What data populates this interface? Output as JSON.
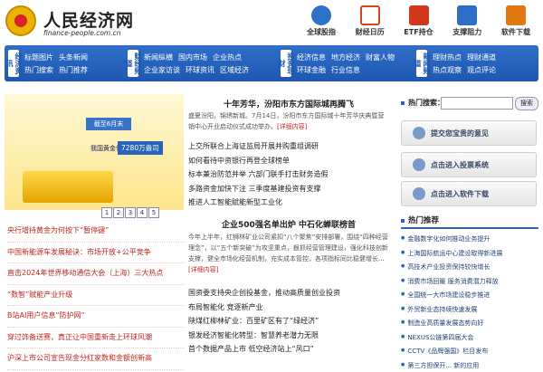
{
  "logo": {
    "name": "人民经济网",
    "url": "finance-people.com.cn"
  },
  "top_icons": [
    {
      "label": "全球股指",
      "icon": "globe-index-icon",
      "color": "#2d72c9"
    },
    {
      "label": "财经日历",
      "icon": "calendar-icon",
      "color": "#d8441c"
    },
    {
      "label": "ETF持仓",
      "icon": "etf-icon",
      "color": "#d0381d"
    },
    {
      "label": "支撑阻力",
      "icon": "support-icon",
      "color": "#2d6fc4"
    },
    {
      "label": "软件下载",
      "icon": "download-icon",
      "color": "#e07a10"
    }
  ],
  "nav": [
    {
      "tag": "经济资讯",
      "links": [
        "标题图片",
        "头条新闻",
        "热门搜索",
        "热门推荐"
      ]
    },
    {
      "tag": "财经频道",
      "links": [
        "新闻纵横",
        "国内市场",
        "企业热点",
        "企业家访谈",
        "环球资讯",
        "区域经济"
      ]
    },
    {
      "tag": "投资理财",
      "links": [
        "经济信息",
        "地方经济",
        "财富人物",
        "环球金融",
        "行业信息"
      ]
    },
    {
      "tag": "新闻频道",
      "links": [
        "理财热点",
        "理财通道",
        "热点观察",
        "观点评论"
      ]
    }
  ],
  "banner": {
    "head": "截至6月末",
    "text": "我国黄金储备为",
    "amount": "7280万盎司"
  },
  "pager": [
    "1",
    "2",
    "3",
    "4",
    "5"
  ],
  "left_list": [
    "央行增持黄金为何按下“暂停键”",
    "中国新能源车发展秘诀：市场开放+公平竞争",
    "直击2024年世界移动通信大会（上海）三大热点",
    "“数智”赋能产业升级",
    "B站AI用户信息“防护网”",
    "穿过饰备送赛，真正让中国重新走上环球风潮",
    "沪深上市公司宣告现金分红家数和金额创新高"
  ],
  "center": {
    "headline1": "十年芳华，汾阳市东方国际城再腾飞",
    "summary1": "盛夏汾阳，锦绣新城。7月14日，汾阳市东方国际城十年芳华庆典暨营销中心开业启动仪式成功举办。",
    "detail_link": "[详细内容]",
    "news1": [
      "上交所联合上海证监局开展并购重组调研",
      "如何看待中资银行再登全球榜单",
      "标本兼治防范并举 六部门联手打击财务造假",
      "多路资金加快下注 三季度基建投资有支撑",
      "推进人工智能赋能新型工业化"
    ],
    "headline2": "企业500强名单出炉 中石化蝉联榜首",
    "summary2": "今年上半年，红狮林矿业公司紧扣“八个聚焦”安排部署，围绕“四种经营理念”，以“五个新突破”为攻坚重点，狠抓经营管理建设，强化科技创新支撑，健全市场化经营机制，充实成本管控，各项指标同比稳健增长...",
    "detail_link2": "[详细内容]",
    "news2": [
      "国资委支持央企创投基金，推动高质量创业投资",
      "布局智能化 竞逐新产业",
      "陕煤红柳林矿业：百里矿区有了“绿经济”",
      "银发经济智能化转型：智慧养老潜力无限",
      "首个数据产品上市 低空经济站上“风口”"
    ]
  },
  "right": {
    "hot_search_label": "热门搜索：",
    "search_button": "搜索",
    "buttons": [
      "提交您宝贵的意见",
      "点击进入投票系统",
      "点击进入软件下载"
    ],
    "recommend_title": "热门推荐",
    "recommend": [
      "金融数字化如何推动业务提升",
      "上海国际航运中心建设取得新进展",
      "高技术产业投资保持较快增长",
      "消费市场回暖 服务消费潜力释放",
      "全国统一大市场建设稳步推进",
      "外贸新业态持续快速发展",
      "制造业高质量发展态势向好",
      "NEXUS公链第四届大会",
      "CCTV《品牌强国》栏目发布",
      "第三方担保开... 新的应用"
    ]
  }
}
